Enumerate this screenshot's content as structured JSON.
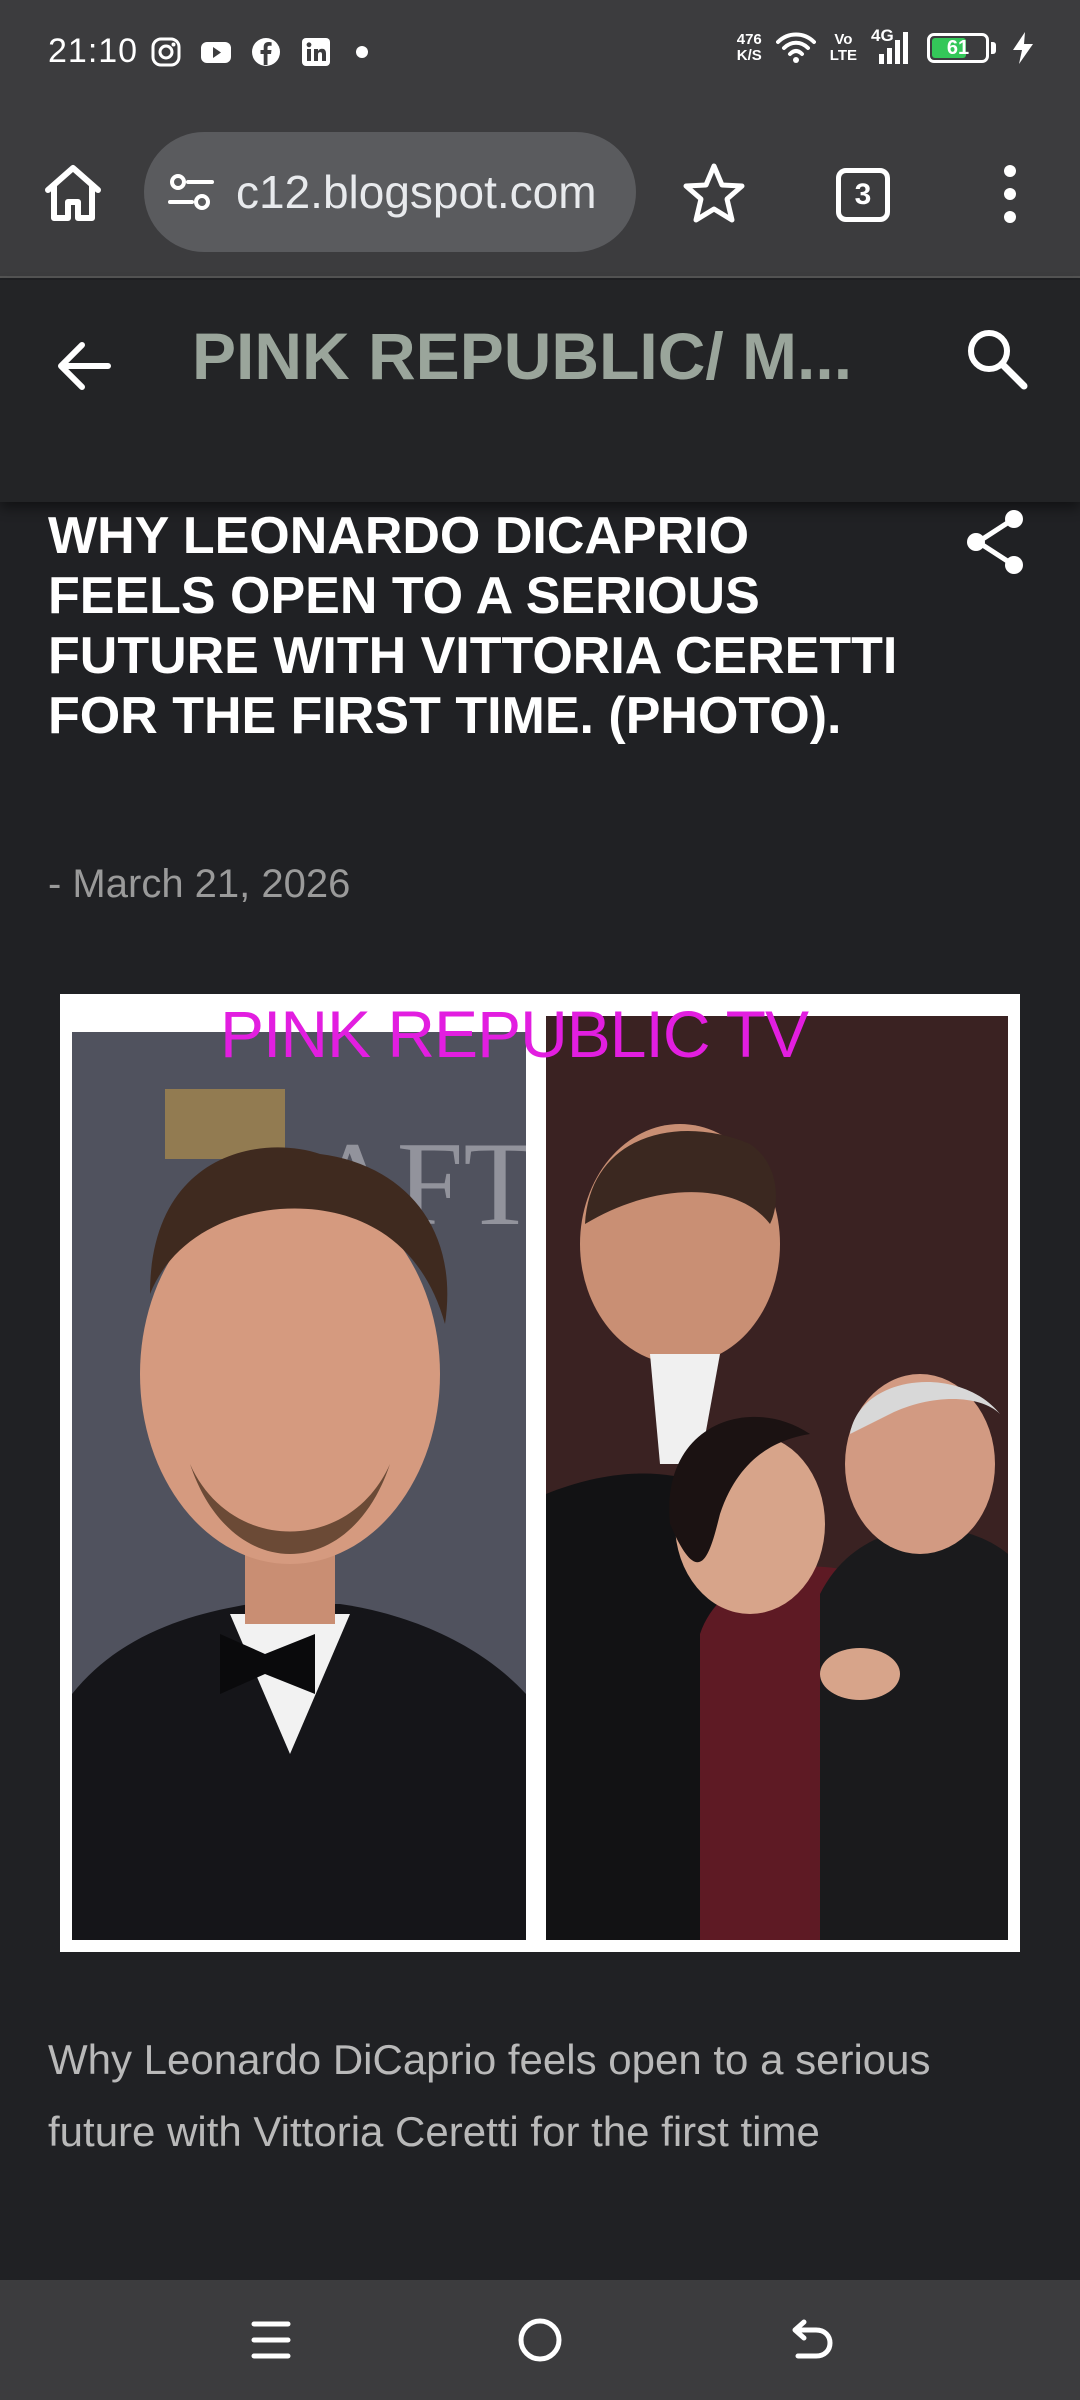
{
  "status_bar": {
    "time": "21:10",
    "app_icons": [
      "instagram-icon",
      "youtube-icon",
      "facebook-icon",
      "linkedin-icon"
    ],
    "net_speed_value": "476",
    "net_speed_unit": "K/S",
    "volte_top": "Vo",
    "volte_bottom": "LTE",
    "network": "4G",
    "battery": "61",
    "battery_color": "#34c759"
  },
  "browser": {
    "url": "c12.blogspot.com",
    "tab_count": "3"
  },
  "blog": {
    "title": "PINK REPUBLIC/ M...",
    "title_color": "#9aa59b"
  },
  "post": {
    "title": "WHY LEONARDO DICAPRIO FEELS OPEN TO A SERIOUS FUTURE WITH VITTORIA CERETTI FOR THE FIRST TIME. (PHOTO).",
    "date": "- March 21, 2026",
    "image_watermark": "PINK REPUBLIC TV",
    "image_watermark_color": "#e21ee0",
    "snippet": " Why Leonardo DiCaprio feels open to a serious future with Vittoria Ceretti for the first time"
  }
}
